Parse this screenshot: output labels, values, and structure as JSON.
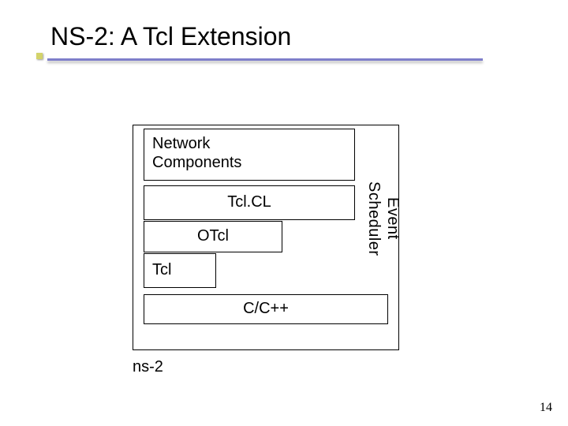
{
  "title": "NS-2: A Tcl Extension",
  "diagram": {
    "network_components": "Network\nComponents",
    "tclcl": "Tcl.CL",
    "otcl": "OTcl",
    "tcl": "Tcl",
    "event_scheduler": "Event\nScheduler",
    "cpp": "C/C++"
  },
  "caption": "ns-2",
  "page_number": "14"
}
